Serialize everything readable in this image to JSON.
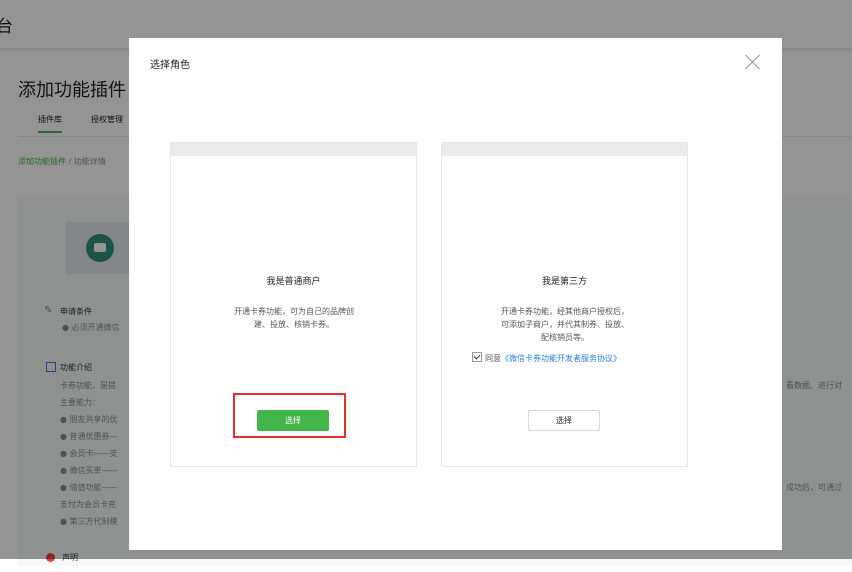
{
  "background": {
    "header_logo": "台",
    "page_title": "添加功能插件",
    "tabs": [
      "插件库",
      "授权管理"
    ],
    "breadcrumb": {
      "link": "添加功能插件",
      "sep": " / ",
      "current": "功能详情"
    },
    "requirements_title": "申请条件",
    "requirements_item": "● 必须开通微信",
    "intro_title": "功能介绍",
    "intro_lines": [
      "卡券功能，是提",
      "主要能力：",
      "● 朋友共享的优",
      "● 普通优惠券—",
      "● 会员卡——支",
      "● 微信买单——",
      "● 储值功能——",
      "支付为会员卡充",
      "● 第三方代制模"
    ],
    "right_text_1": "看数据、进行对",
    "right_text_2": "成功后，可通过",
    "bottom_label": "声明"
  },
  "dialog": {
    "title": "选择角色",
    "roles": [
      {
        "name": "我是普通商户",
        "desc_lines": [
          "开通卡券功能，可为自己的品牌创",
          "建、投放、核销卡券。"
        ],
        "button": "选择"
      },
      {
        "name": "我是第三方",
        "desc_lines": [
          "开通卡券功能，经其他商户授权后，",
          "可添加子商户，并代其制券、投放、",
          "配核销员等。"
        ],
        "agree_prefix": "同意",
        "agree_link": "《微信卡券功能开发者服务协议》",
        "agree_checked": true,
        "button": "选择"
      }
    ]
  },
  "colors": {
    "accent": "#44b549",
    "link": "#2e7de1",
    "highlight": "#e0312e"
  }
}
